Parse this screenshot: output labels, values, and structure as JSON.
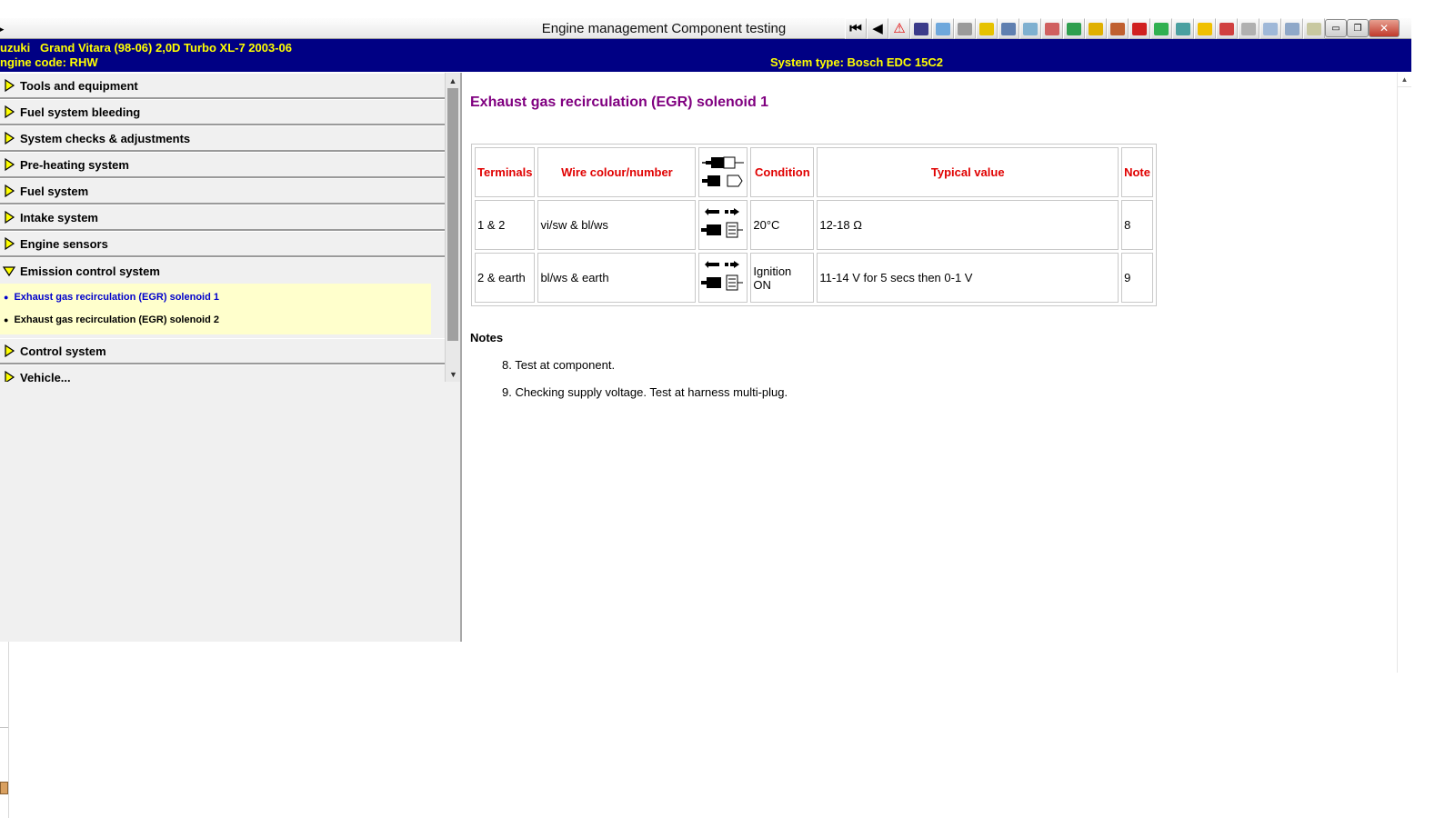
{
  "window": {
    "title": "Engine management Component testing"
  },
  "toolbar": {
    "icons": [
      {
        "name": "first-page-icon",
        "glyph": "⏮",
        "color": ""
      },
      {
        "name": "previous-page-icon",
        "glyph": "◀",
        "color": ""
      },
      {
        "name": "warning-icon",
        "glyph": "⚠",
        "color": "#e00000"
      },
      {
        "name": "book-icon",
        "glyph": "",
        "color": "#3b3b8a"
      },
      {
        "name": "engine-diagram-icon",
        "glyph": "",
        "color": "#6fa8dc"
      },
      {
        "name": "oil-drop-icon",
        "glyph": "",
        "color": "#9a9a9a"
      },
      {
        "name": "wrench-yellow-icon",
        "glyph": "",
        "color": "#e6c200"
      },
      {
        "name": "gauge-icon",
        "glyph": "",
        "color": "#5f7fb0"
      },
      {
        "name": "injector-icon",
        "glyph": "",
        "color": "#7fb0d0"
      },
      {
        "name": "wiring-icon",
        "glyph": "",
        "color": "#d06060"
      },
      {
        "name": "chart-green-icon",
        "glyph": "",
        "color": "#2f9f4f"
      },
      {
        "name": "sensor-icon",
        "glyph": "",
        "color": "#e0b000"
      },
      {
        "name": "tools-icon",
        "glyph": "",
        "color": "#c06030"
      },
      {
        "name": "battery-icon",
        "glyph": "",
        "color": "#d02020"
      },
      {
        "name": "service-green-icon",
        "glyph": "",
        "color": "#30b050"
      },
      {
        "name": "diagnostics-icon",
        "glyph": "",
        "color": "#4aa0a0"
      },
      {
        "name": "fuse-icon",
        "glyph": "",
        "color": "#f0c000"
      },
      {
        "name": "repair-icon",
        "glyph": "",
        "color": "#d04040"
      },
      {
        "name": "bulb-icon",
        "glyph": "",
        "color": "#b0b0b0"
      },
      {
        "name": "alert-outline-icon",
        "glyph": "",
        "color": "#9fb8d8"
      },
      {
        "name": "settings-icon",
        "glyph": "",
        "color": "#8fa8c8"
      },
      {
        "name": "info-icon",
        "glyph": "",
        "color": "#c8c8a0"
      }
    ],
    "win_minimize": "▭",
    "win_restore": "❐",
    "win_close": "✕"
  },
  "vehicle": {
    "line": "uzuki   Grand Vitara (98-06) 2,0D Turbo XL-7 2003-06",
    "engine_code": "ngine code: RHW",
    "system_type": "System type: Bosch EDC 15C2"
  },
  "nav": {
    "sections": [
      {
        "label": "Tools and equipment"
      },
      {
        "label": "Fuel system bleeding"
      },
      {
        "label": "System checks & adjustments"
      },
      {
        "label": "Pre-heating system"
      },
      {
        "label": "Fuel system"
      },
      {
        "label": "Intake system"
      },
      {
        "label": "Engine sensors"
      },
      {
        "label": "Emission control system"
      },
      {
        "label": "Control system"
      },
      {
        "label": "Vehicle..."
      }
    ],
    "emission_items": [
      {
        "label": "Exhaust gas recirculation (EGR) solenoid 1"
      },
      {
        "label": "Exhaust gas recirculation (EGR) solenoid 2"
      }
    ]
  },
  "content": {
    "title": "Exhaust gas recirculation (EGR) solenoid 1",
    "table": {
      "headers": {
        "terminals": "Terminals",
        "wire": "Wire colour/number",
        "condition": "Condition",
        "typical": "Typical value",
        "note": "Note"
      },
      "rows": [
        {
          "terminals": "1 & 2",
          "wire": "vi/sw & bl/ws",
          "condition": "20°C",
          "typical": "12-18 Ω",
          "note": "8"
        },
        {
          "terminals": "2 & earth",
          "wire": "bl/ws & earth",
          "condition": "Ignition ON",
          "typical": "11-14 V for 5 secs then 0-1 V",
          "note": "9"
        }
      ]
    },
    "notes_title": "Notes",
    "notes": [
      "8. Test at component.",
      "9. Checking supply voltage. Test at harness multi-plug."
    ]
  },
  "colors": {
    "info_bar_bg": "#000084",
    "info_bar_text": "#ffff00",
    "page_title": "#800080",
    "table_header": "#e00000",
    "active_link": "#0000cc",
    "sublist_bg": "#ffffcc"
  }
}
